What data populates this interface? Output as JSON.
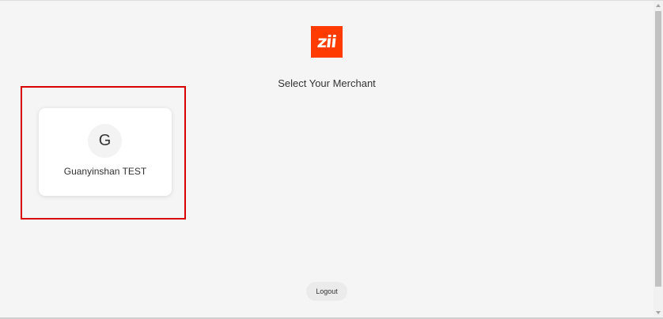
{
  "brand": {
    "logo_text": "zii",
    "logo_color": "#ff3b00"
  },
  "page": {
    "heading": "Select Your Merchant"
  },
  "merchants": [
    {
      "initial": "G",
      "name": "Guanyinshan TEST"
    }
  ],
  "actions": {
    "logout_label": "Logout"
  },
  "annotation": {
    "highlight_color": "#d60000"
  }
}
